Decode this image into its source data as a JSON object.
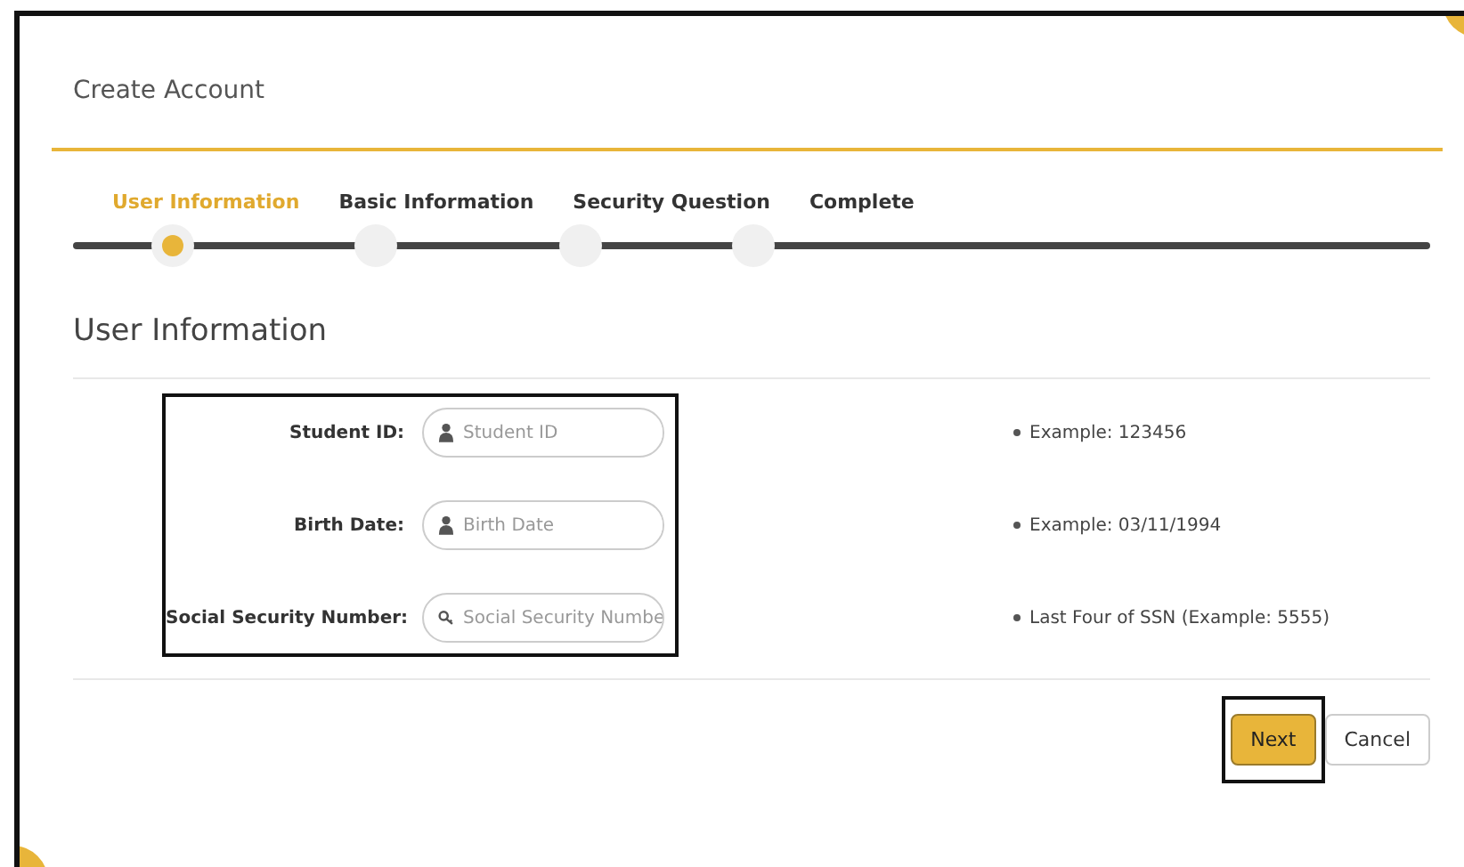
{
  "title": "Create Account",
  "steps": [
    {
      "label": "User Information",
      "selected": true
    },
    {
      "label": "Basic Information",
      "selected": false
    },
    {
      "label": "Security Question",
      "selected": false
    },
    {
      "label": "Complete",
      "selected": false
    }
  ],
  "section_title": "User Information",
  "fields": [
    {
      "label": "Student ID:",
      "placeholder": "Student ID",
      "hint": "Example: 123456"
    },
    {
      "label": "Birth Date:",
      "placeholder": "Birth Date",
      "hint": "Example: 03/11/1994"
    },
    {
      "label": "Social Security Number:",
      "placeholder": "Social Security Numbe",
      "hint": "Last Four of SSN (Example: 5555)"
    }
  ],
  "buttons": [
    {
      "label": "Next",
      "kind": "primary"
    },
    {
      "label": "Cancel",
      "kind": "secondary"
    }
  ]
}
